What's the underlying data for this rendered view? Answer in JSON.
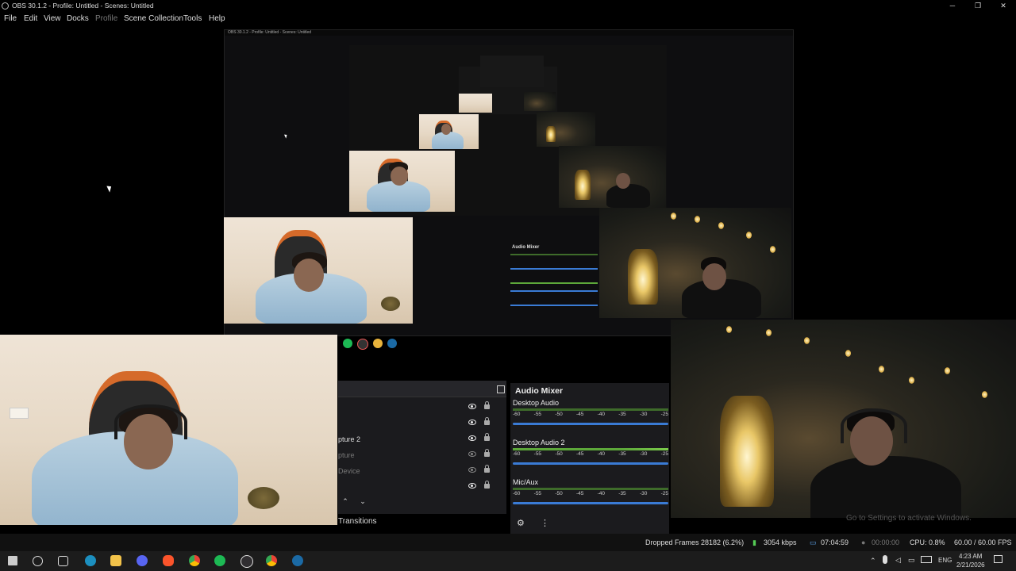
{
  "window": {
    "title": "OBS 30.1.2 - Profile: Untitled - Scenes: Untitled",
    "minimize": "─",
    "maximize": "❐",
    "close": "✕"
  },
  "menu": {
    "file": "File",
    "edit": "Edit",
    "view": "View",
    "docks": "Docks",
    "profile": "Profile",
    "scene_collection": "Scene Collection",
    "tools": "Tools",
    "help": "Help"
  },
  "sources": [
    {
      "label": "",
      "visible": true,
      "dim": false
    },
    {
      "label": "",
      "visible": true,
      "dim": false
    },
    {
      "label": "pture 2",
      "visible": true,
      "dim": false
    },
    {
      "label": "pture",
      "visible": false,
      "dim": true
    },
    {
      "label": "Device",
      "visible": false,
      "dim": true
    },
    {
      "label": "",
      "visible": true,
      "dim": false
    }
  ],
  "sources_controls": {
    "up": "⌃",
    "down": "⌄"
  },
  "transitions_tab": "Transitions",
  "audio_mixer": {
    "title": "Audio Mixer",
    "channels": [
      {
        "name": "Desktop Audio"
      },
      {
        "name": "Desktop Audio 2"
      },
      {
        "name": "Mic/Aux"
      }
    ],
    "scale": [
      "-60",
      "-55",
      "-50",
      "-45",
      "-40",
      "-35",
      "-30",
      "-25"
    ],
    "gear": "⚙",
    "more": "⋮"
  },
  "status": {
    "dropped_frames": "Dropped Frames 28182 (6.2%)",
    "bitrate": "3054 kbps",
    "stream_time": "07:04:59",
    "rec_time": "00:00:00",
    "cpu": "CPU: 0.8%",
    "fps": "60.00 / 60.00 FPS"
  },
  "tray": {
    "lang": "ENG",
    "time": "4:23 AM",
    "date": "2/21/2026"
  },
  "activate_windows": "Go to Settings to activate Windows."
}
